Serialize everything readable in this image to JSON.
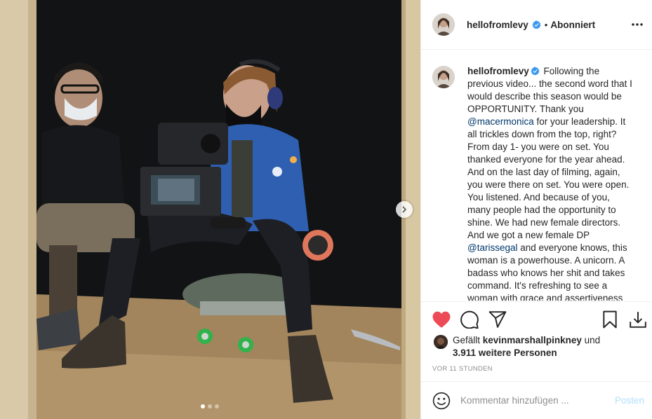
{
  "post": {
    "username": "hellofromlevy",
    "verified": true,
    "follow_separator": "•",
    "follow_state": "Abonniert",
    "caption": {
      "username": "hellofromlevy",
      "part1": " Following the previous video... the second word that I would describe this season would be OPPORTUNITY. Thank you ",
      "mention1": "@macermonica",
      "part2": " for your leadership. It all trickles down from the top, right? From day 1- you were on set. You thanked everyone for the year ahead. And on the last day of filming, again, you were there on set. You were open. You listened. And because of you, many people had the opportunity to shine. We had new female directors. And we got a new female DP ",
      "mention2": "@tarissegal",
      "part3": " and everyone knows, this woman is a powerhouse. A unicorn. A badass who knows her shit and takes command. It's refreshing to see a woman with grace and assertiveness"
    },
    "likes": {
      "prefix": "Gefällt ",
      "liker": "kevinmarshallpinkney",
      "middle": " und",
      "others": "3.911 weitere Personen"
    },
    "timestamp": "VOR 11 STUNDEN",
    "comment": {
      "placeholder": "Kommentar hinzufügen ...",
      "post_label": "Posten"
    },
    "carousel": {
      "total": 3,
      "active": 1
    }
  },
  "icons": {
    "verified": "verified-badge-icon",
    "more": "more-options-icon",
    "like": "heart-icon",
    "comment": "comment-icon",
    "share": "paper-plane-icon",
    "save": "bookmark-icon",
    "download": "download-icon",
    "emoji": "smiley-icon",
    "next": "chevron-right-icon"
  },
  "colors": {
    "like_red": "#ed4956",
    "verified_blue": "#3897f0",
    "mention_blue": "#00376b",
    "post_disabled": "#b2dffc",
    "meta_grey": "#8e8e8e"
  }
}
